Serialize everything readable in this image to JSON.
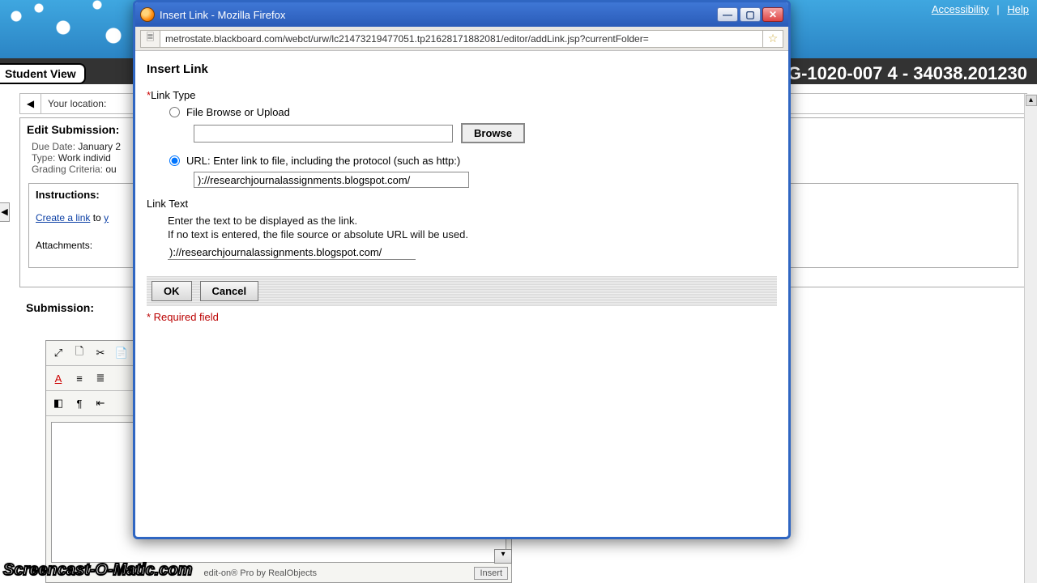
{
  "top_links": {
    "accessibility": "Accessibility",
    "help": "Help"
  },
  "student_view": "Student View",
  "course_title": "G-1020-007 4 - 34038.201230",
  "breadcrumb": {
    "label": "Your location:"
  },
  "edit_submission": {
    "heading": "Edit Submission:",
    "due_label": "Due Date:",
    "due_value": "January 2",
    "type_label": "Type:",
    "type_value": "Work individ",
    "grading_label": "Grading Criteria:",
    "grading_value": "ou"
  },
  "instructions": {
    "heading": "Instructions:",
    "create_link": "Create a link",
    "to_word": "to",
    "rest": "y",
    "attachments_label": "Attachments:"
  },
  "submission_label": "Submission:",
  "editor": {
    "credit": "edit-on® Pro by RealObjects",
    "mode": "Insert"
  },
  "dialog": {
    "window_title": "Insert Link - Mozilla Firefox",
    "url": "metrostate.blackboard.com/webct/urw/lc21473219477051.tp21628171882081/editor/addLink.jsp?currentFolder=",
    "heading": "Insert Link",
    "link_type_label": "Link Type",
    "opt_file": "File Browse or Upload",
    "browse_btn": "Browse",
    "opt_url": "URL: Enter link to file, including the protocol (such as http:)",
    "url_value": ")://researchjournalassignments.blogspot.com/",
    "link_text_label": "Link Text",
    "hint1": "Enter the text to be displayed as the link.",
    "hint2": "If no text is entered, the file source or absolute URL will be used.",
    "link_text_value": ")://researchjournalassignments.blogspot.com/",
    "ok": "OK",
    "cancel": "Cancel",
    "required": "* Required field"
  },
  "watermark": "Screencast-O-Matic.com"
}
